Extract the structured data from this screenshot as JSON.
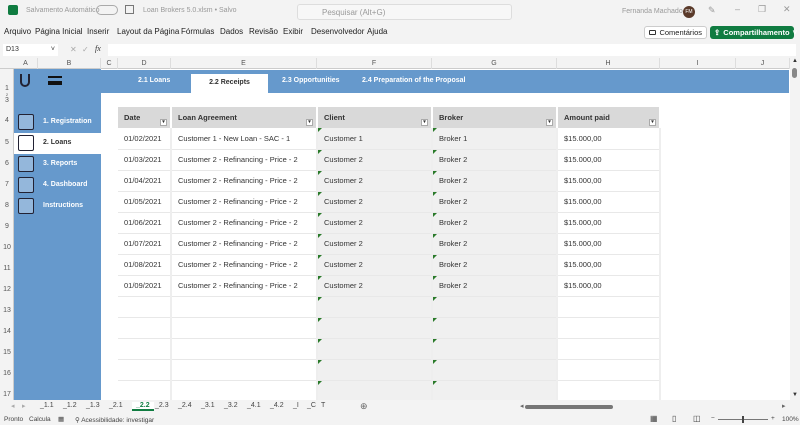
{
  "titlebar": {
    "autosave": "Salvamento Automático",
    "file": "Loan Brokers 5.0.xlsm • Salvo",
    "search_placeholder": "Pesquisar (Alt+G)",
    "user": "Fernanda Machado",
    "initials": "FM"
  },
  "menu": [
    "Arquivo",
    "Página Inicial",
    "Inserir",
    "Layout da Página",
    "Fórmulas",
    "Dados",
    "Revisão",
    "Exibir",
    "Desenvolvedor",
    "Ajuda"
  ],
  "buttons": {
    "comments": "Comentários",
    "share": "Compartilhamento"
  },
  "formula_bar": {
    "cell": "D13",
    "fx": "fx",
    "value": ""
  },
  "columns": [
    "A",
    "B",
    "C",
    "D",
    "E",
    "F",
    "G",
    "H",
    "I",
    "J"
  ],
  "rows": [
    "1",
    "2",
    "3",
    "4",
    "5",
    "6",
    "7",
    "8",
    "9",
    "10",
    "11",
    "12",
    "13",
    "14",
    "15",
    "16",
    "17"
  ],
  "tabs": [
    "2.1 Loans",
    "2.2 Receipts",
    "2.3 Opportunities",
    "2.4 Preparation of the Proposal"
  ],
  "nav": [
    "1. Registration",
    "2. Loans",
    "3. Reports",
    "4. Dashboard",
    "Instructions"
  ],
  "table": {
    "headers": [
      "Date",
      "Loan Agreement",
      "Client",
      "Broker",
      "Amount paid"
    ],
    "rows": [
      [
        "01/02/2021",
        "Customer 1 - New Loan - SAC - 1",
        "Customer 1",
        "Broker 1",
        "$15.000,00"
      ],
      [
        "01/03/2021",
        "Customer 2 - Refinancing - Price - 2",
        "Customer 2",
        "Broker 2",
        "$15.000,00"
      ],
      [
        "01/04/2021",
        "Customer 2 - Refinancing - Price - 2",
        "Customer 2",
        "Broker 2",
        "$15.000,00"
      ],
      [
        "01/05/2021",
        "Customer 2 - Refinancing - Price - 2",
        "Customer 2",
        "Broker 2",
        "$15.000,00"
      ],
      [
        "01/06/2021",
        "Customer 2 - Refinancing - Price - 2",
        "Customer 2",
        "Broker 2",
        "$15.000,00"
      ],
      [
        "01/07/2021",
        "Customer 2 - Refinancing - Price - 2",
        "Customer 2",
        "Broker 2",
        "$15.000,00"
      ],
      [
        "01/08/2021",
        "Customer 2 - Refinancing - Price - 2",
        "Customer 2",
        "Broker 2",
        "$15.000,00"
      ],
      [
        "01/09/2021",
        "Customer 2 - Refinancing - Price - 2",
        "Customer 2",
        "Broker 2",
        "$15.000,00"
      ]
    ]
  },
  "sheets": [
    "_1.1",
    "_1.2",
    "_1.3",
    "_2.1",
    "_2.2",
    "_2.3",
    "_2.4",
    "_3.1",
    "_3.2",
    "_4.1",
    "_4.2",
    "_I",
    "_C",
    "T"
  ],
  "active_sheet": "_2.2",
  "status": {
    "ready": "Pronto",
    "calc": "Calcula",
    "accessibility": "Acessibilidade: investigar",
    "zoom": "100%"
  },
  "colors": {
    "accent": "#6699cc",
    "share": "#107c41"
  }
}
